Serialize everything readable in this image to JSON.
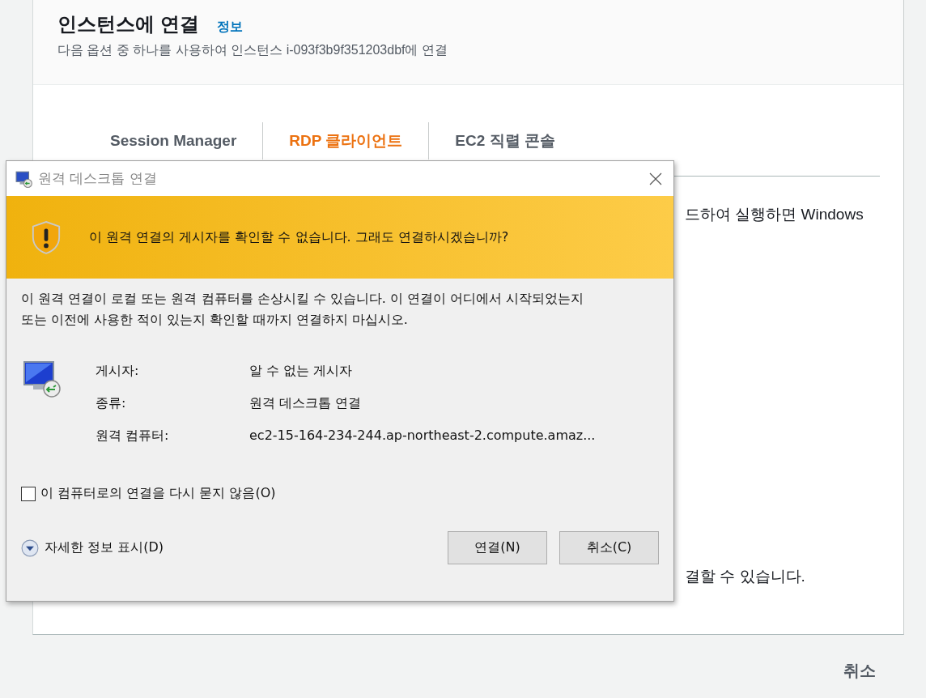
{
  "page": {
    "title": "인스턴스에 연결",
    "info_link": "정보",
    "subtitle": "다음 옵션 중 하나를 사용하여 인스턴스 i-093f3b9f351203dbf에 연결",
    "tabs": [
      {
        "label": "Session Manager",
        "selected": false
      },
      {
        "label": "RDP 클라이언트",
        "selected": true
      },
      {
        "label": "EC2 직렬 콘솔",
        "selected": false
      }
    ],
    "body_lines": [
      "드하여 실행하면 Windows",
      "결할 수 있습니다."
    ],
    "cancel": "취소"
  },
  "dialog": {
    "title": "원격 데스크톱 연결",
    "warning": "이 원격 연결의 게시자를 확인할 수 없습니다. 그래도 연결하시겠습니까?",
    "description": "이 원격 연결이 로컬 또는 원격 컴퓨터를 손상시킬 수 있습니다. 이 연결이 어디에서 시작되었는지 또는 이전에 사용한 적이 있는지 확인할 때까지 연결하지 마십시오.",
    "details": [
      {
        "label": "게시자:",
        "value": "알 수 없는 게시자"
      },
      {
        "label": "종류:",
        "value": "원격 데스크톱 연결"
      },
      {
        "label": "원격 컴퓨터:",
        "value": "ec2-15-164-234-244.ap-northeast-2.compute.amaz..."
      }
    ],
    "checkbox": {
      "label": "이 컴퓨터로의 연결을 다시 묻지 않음(O)",
      "checked": false
    },
    "details_toggle": "자세한 정보 표시(D)",
    "buttons": [
      "연결(N)",
      "취소(C)"
    ]
  }
}
